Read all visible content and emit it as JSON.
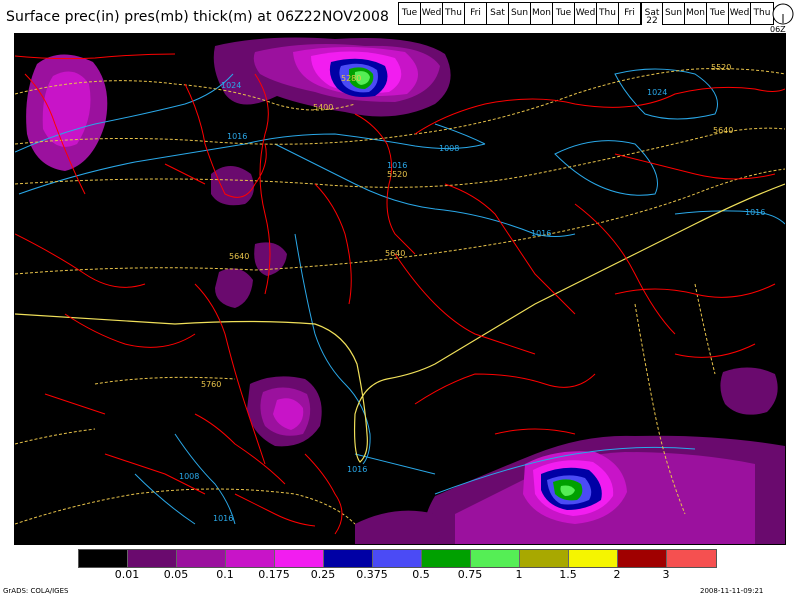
{
  "title": "Surface prec(in) pres(mb) thick(m) at 06Z22NOV2008",
  "day_strip": {
    "days": [
      "Tue",
      "Wed",
      "Thu",
      "Fri",
      "Sat",
      "Sun",
      "Mon",
      "Tue",
      "Wed",
      "Thu",
      "Fri",
      "Sat",
      "Sun",
      "Mon",
      "Tue",
      "Wed",
      "Thu"
    ],
    "active_index": 11,
    "active_date": "22"
  },
  "clock_label": "06Z",
  "contour_labels": {
    "l5280": "5280",
    "l5400": "5400",
    "l5520a": "5520",
    "l5520b": "5520",
    "l5640a": "5640",
    "l5640b": "5640",
    "l5640c": "5640",
    "l5760": "5760",
    "p1024a": "1024",
    "p1024b": "1024",
    "p1016a": "1016",
    "p1016b": "1016",
    "p1016c": "1016",
    "p1016d": "1016",
    "p1016e": "1016",
    "p1016f": "1016",
    "p1008a": "1008",
    "p1008b": "1008"
  },
  "colorbar": {
    "colors": [
      "#000000",
      "#6a0a6e",
      "#9b119e",
      "#c814c8",
      "#f21df0",
      "#0000a5",
      "#4b4bf5",
      "#00a000",
      "#55ee55",
      "#a8a800",
      "#f5f500",
      "#a00000",
      "#f55050"
    ],
    "labels": [
      "0.01",
      "0.05",
      "0.1",
      "0.175",
      "0.25",
      "0.375",
      "0.5",
      "0.75",
      "1",
      "1.5",
      "2",
      "3"
    ]
  },
  "footer_left": "GrADS: COLA/IGES",
  "footer_right": "2008-11-11-09:21",
  "colors": {
    "coastline": "#ff0000",
    "isobar": "#2aa8e8",
    "thickness": "#e8c34a",
    "thickness_main": "#f0e05a"
  }
}
